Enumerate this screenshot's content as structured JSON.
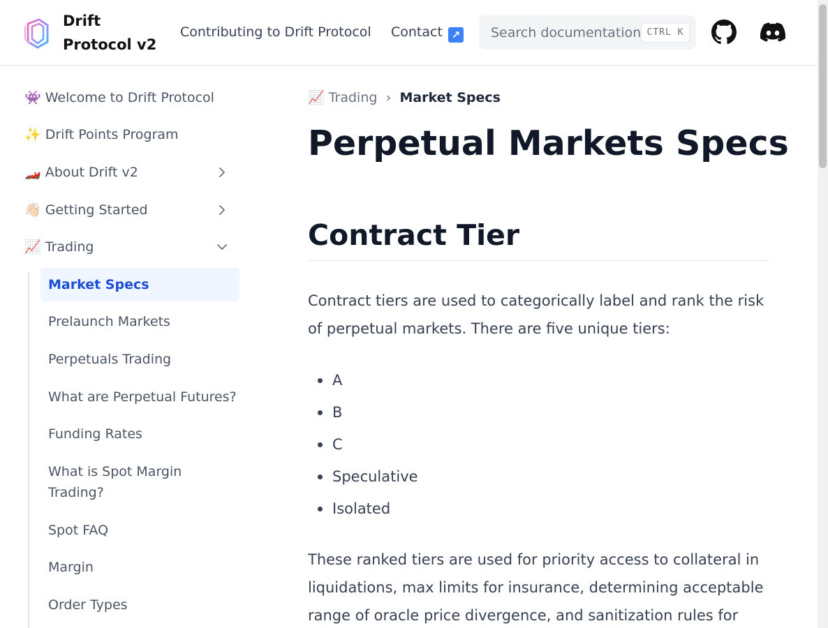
{
  "header": {
    "brand": "Drift Protocol v2",
    "nav": [
      {
        "label": "Contributing to Drift Protocol"
      },
      {
        "label": "Contact"
      }
    ],
    "search": {
      "placeholder": "Search documentation...",
      "shortcut": "CTRL K"
    }
  },
  "sidebar": {
    "items": [
      {
        "emoji": "👾",
        "label": "Welcome to Drift Protocol"
      },
      {
        "emoji": "✨",
        "label": "Drift Points Program"
      },
      {
        "emoji": "🏎️",
        "label": "About Drift v2"
      },
      {
        "emoji": "👋🏻",
        "label": "Getting Started"
      },
      {
        "emoji": "📈",
        "label": "Trading"
      }
    ],
    "trading_children": [
      {
        "label": "Market Specs",
        "active": true
      },
      {
        "label": "Prelaunch Markets"
      },
      {
        "label": "Perpetuals Trading"
      },
      {
        "label": "What are Perpetual Futures?"
      },
      {
        "label": "Funding Rates"
      },
      {
        "label": "What is Spot Margin Trading?"
      },
      {
        "label": "Spot FAQ"
      },
      {
        "label": "Margin"
      },
      {
        "label": "Order Types"
      }
    ]
  },
  "breadcrumb": {
    "parent_emoji": "📈",
    "parent": "Trading",
    "current": "Market Specs"
  },
  "content": {
    "title": "Perpetual Markets Specs",
    "section_title": "Contract Tier",
    "intro": "Contract tiers are used to categorically label and rank the risk of perpetual markets. There are five unique tiers:",
    "tiers": [
      "A",
      "B",
      "C",
      "Speculative",
      "Isolated"
    ],
    "para2": "These ranked tiers are used for priority access to collateral in liquidations, max limits for insurance, determining acceptable range of oracle price divergence, and sanitization rules for"
  }
}
